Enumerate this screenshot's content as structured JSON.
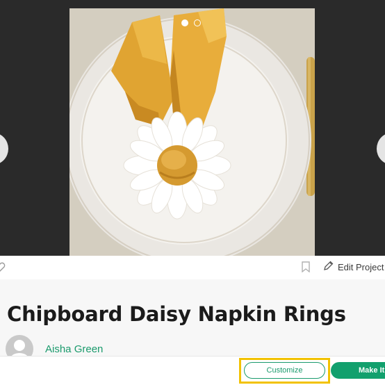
{
  "carousel": {
    "image_alt": "Chipboard daisy napkin ring on a yellow napkin and white plate",
    "slide_count": 2,
    "active_slide": 1
  },
  "actions": {
    "edit_label": "Edit Project"
  },
  "project": {
    "title": "Chipboard Daisy Napkin Rings",
    "author": "Aisha Green"
  },
  "buttons": {
    "customize_label": "Customize",
    "make_it_label": "Make It"
  },
  "colors": {
    "accent": "#1a9a6c",
    "highlight": "#f2c200"
  }
}
